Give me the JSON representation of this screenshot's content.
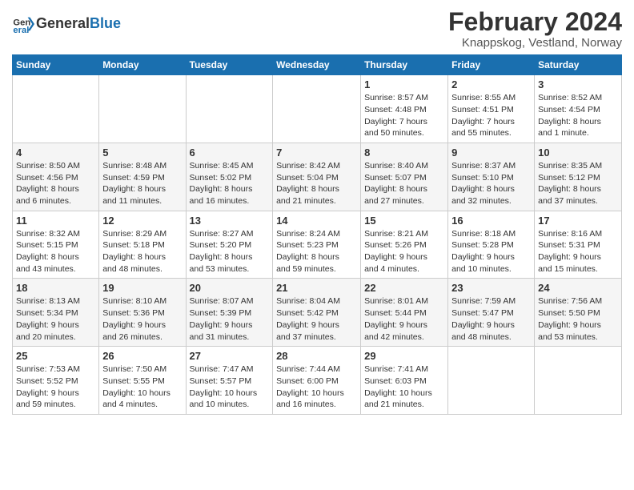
{
  "logo": {
    "text_general": "General",
    "text_blue": "Blue"
  },
  "title": "February 2024",
  "subtitle": "Knappskog, Vestland, Norway",
  "weekdays": [
    "Sunday",
    "Monday",
    "Tuesday",
    "Wednesday",
    "Thursday",
    "Friday",
    "Saturday"
  ],
  "rows": [
    [
      {
        "day": "",
        "info": ""
      },
      {
        "day": "",
        "info": ""
      },
      {
        "day": "",
        "info": ""
      },
      {
        "day": "",
        "info": ""
      },
      {
        "day": "1",
        "info": "Sunrise: 8:57 AM\nSunset: 4:48 PM\nDaylight: 7 hours\nand 50 minutes."
      },
      {
        "day": "2",
        "info": "Sunrise: 8:55 AM\nSunset: 4:51 PM\nDaylight: 7 hours\nand 55 minutes."
      },
      {
        "day": "3",
        "info": "Sunrise: 8:52 AM\nSunset: 4:54 PM\nDaylight: 8 hours\nand 1 minute."
      }
    ],
    [
      {
        "day": "4",
        "info": "Sunrise: 8:50 AM\nSunset: 4:56 PM\nDaylight: 8 hours\nand 6 minutes."
      },
      {
        "day": "5",
        "info": "Sunrise: 8:48 AM\nSunset: 4:59 PM\nDaylight: 8 hours\nand 11 minutes."
      },
      {
        "day": "6",
        "info": "Sunrise: 8:45 AM\nSunset: 5:02 PM\nDaylight: 8 hours\nand 16 minutes."
      },
      {
        "day": "7",
        "info": "Sunrise: 8:42 AM\nSunset: 5:04 PM\nDaylight: 8 hours\nand 21 minutes."
      },
      {
        "day": "8",
        "info": "Sunrise: 8:40 AM\nSunset: 5:07 PM\nDaylight: 8 hours\nand 27 minutes."
      },
      {
        "day": "9",
        "info": "Sunrise: 8:37 AM\nSunset: 5:10 PM\nDaylight: 8 hours\nand 32 minutes."
      },
      {
        "day": "10",
        "info": "Sunrise: 8:35 AM\nSunset: 5:12 PM\nDaylight: 8 hours\nand 37 minutes."
      }
    ],
    [
      {
        "day": "11",
        "info": "Sunrise: 8:32 AM\nSunset: 5:15 PM\nDaylight: 8 hours\nand 43 minutes."
      },
      {
        "day": "12",
        "info": "Sunrise: 8:29 AM\nSunset: 5:18 PM\nDaylight: 8 hours\nand 48 minutes."
      },
      {
        "day": "13",
        "info": "Sunrise: 8:27 AM\nSunset: 5:20 PM\nDaylight: 8 hours\nand 53 minutes."
      },
      {
        "day": "14",
        "info": "Sunrise: 8:24 AM\nSunset: 5:23 PM\nDaylight: 8 hours\nand 59 minutes."
      },
      {
        "day": "15",
        "info": "Sunrise: 8:21 AM\nSunset: 5:26 PM\nDaylight: 9 hours\nand 4 minutes."
      },
      {
        "day": "16",
        "info": "Sunrise: 8:18 AM\nSunset: 5:28 PM\nDaylight: 9 hours\nand 10 minutes."
      },
      {
        "day": "17",
        "info": "Sunrise: 8:16 AM\nSunset: 5:31 PM\nDaylight: 9 hours\nand 15 minutes."
      }
    ],
    [
      {
        "day": "18",
        "info": "Sunrise: 8:13 AM\nSunset: 5:34 PM\nDaylight: 9 hours\nand 20 minutes."
      },
      {
        "day": "19",
        "info": "Sunrise: 8:10 AM\nSunset: 5:36 PM\nDaylight: 9 hours\nand 26 minutes."
      },
      {
        "day": "20",
        "info": "Sunrise: 8:07 AM\nSunset: 5:39 PM\nDaylight: 9 hours\nand 31 minutes."
      },
      {
        "day": "21",
        "info": "Sunrise: 8:04 AM\nSunset: 5:42 PM\nDaylight: 9 hours\nand 37 minutes."
      },
      {
        "day": "22",
        "info": "Sunrise: 8:01 AM\nSunset: 5:44 PM\nDaylight: 9 hours\nand 42 minutes."
      },
      {
        "day": "23",
        "info": "Sunrise: 7:59 AM\nSunset: 5:47 PM\nDaylight: 9 hours\nand 48 minutes."
      },
      {
        "day": "24",
        "info": "Sunrise: 7:56 AM\nSunset: 5:50 PM\nDaylight: 9 hours\nand 53 minutes."
      }
    ],
    [
      {
        "day": "25",
        "info": "Sunrise: 7:53 AM\nSunset: 5:52 PM\nDaylight: 9 hours\nand 59 minutes."
      },
      {
        "day": "26",
        "info": "Sunrise: 7:50 AM\nSunset: 5:55 PM\nDaylight: 10 hours\nand 4 minutes."
      },
      {
        "day": "27",
        "info": "Sunrise: 7:47 AM\nSunset: 5:57 PM\nDaylight: 10 hours\nand 10 minutes."
      },
      {
        "day": "28",
        "info": "Sunrise: 7:44 AM\nSunset: 6:00 PM\nDaylight: 10 hours\nand 16 minutes."
      },
      {
        "day": "29",
        "info": "Sunrise: 7:41 AM\nSunset: 6:03 PM\nDaylight: 10 hours\nand 21 minutes."
      },
      {
        "day": "",
        "info": ""
      },
      {
        "day": "",
        "info": ""
      }
    ]
  ]
}
